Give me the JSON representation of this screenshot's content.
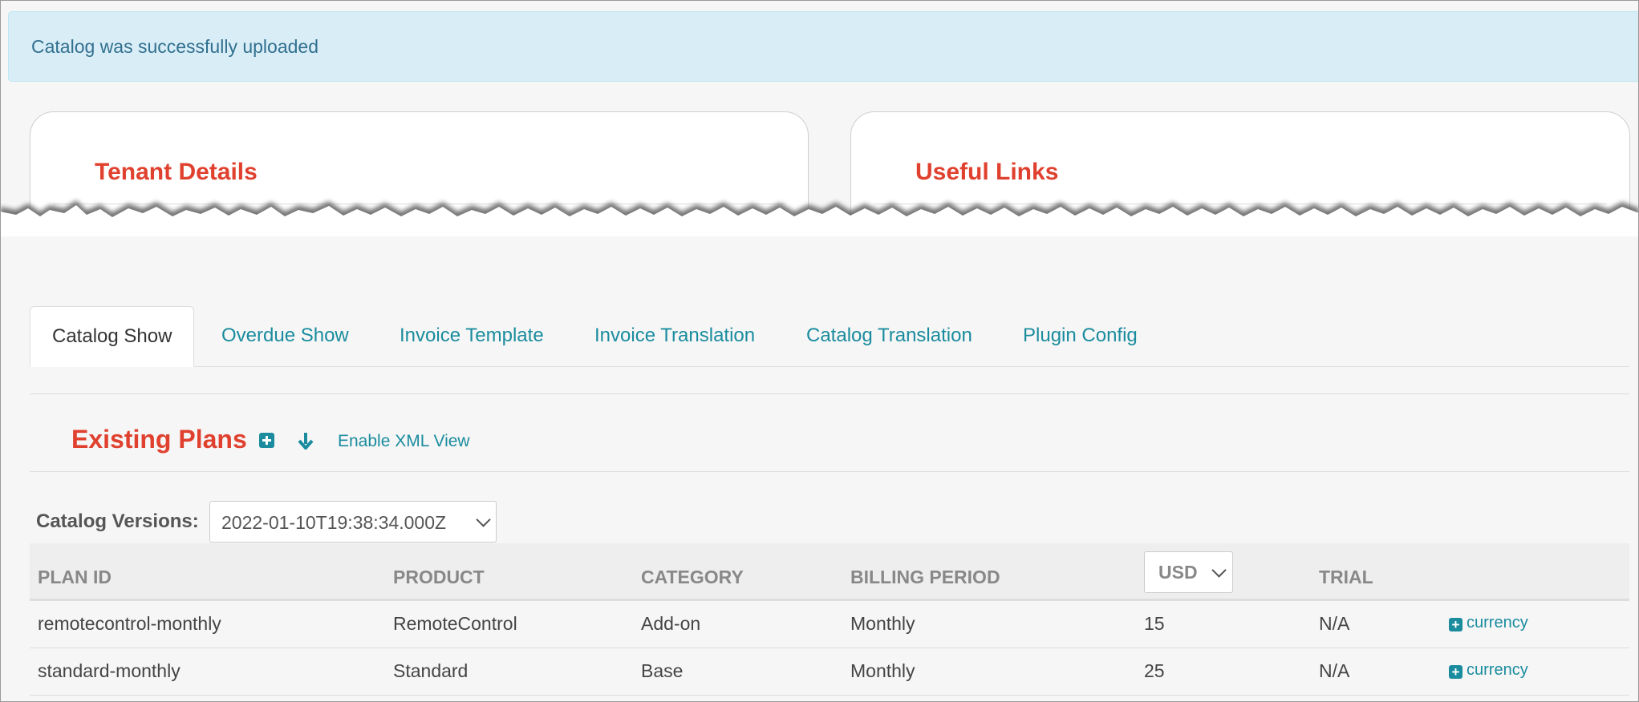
{
  "alert": {
    "message": "Catalog was successfully uploaded"
  },
  "panels": {
    "tenant_title": "Tenant Details",
    "links_title": "Useful Links"
  },
  "tabs": [
    {
      "label": "Catalog Show",
      "active": true
    },
    {
      "label": "Overdue Show"
    },
    {
      "label": "Invoice Template"
    },
    {
      "label": "Invoice Translation"
    },
    {
      "label": "Catalog Translation"
    },
    {
      "label": "Plugin Config"
    }
  ],
  "plans": {
    "title": "Existing Plans",
    "add_icon": "plus-square-icon",
    "download_icon": "arrow-down-icon",
    "xml_link": "Enable XML View"
  },
  "catalog_versions": {
    "label": "Catalog Versions:",
    "selected": "2022-01-10T19:38:34.000Z"
  },
  "table": {
    "headers": {
      "plan_id": "PLAN ID",
      "product": "PRODUCT",
      "category": "CATEGORY",
      "billing_period": "BILLING PERIOD",
      "currency": "USD",
      "trial": "TRIAL"
    },
    "rows": [
      {
        "plan_id": "remotecontrol-monthly",
        "product": "RemoteControl",
        "category": "Add-on",
        "billing_period": "Monthly",
        "price": "15",
        "trial": "N/A",
        "action": "currency"
      },
      {
        "plan_id": "standard-monthly",
        "product": "Standard",
        "category": "Base",
        "billing_period": "Monthly",
        "price": "25",
        "trial": "N/A",
        "action": "currency"
      }
    ]
  },
  "colors": {
    "accent": "#e0412f",
    "link": "#1a8c9e",
    "alert_bg": "#d9edf7",
    "alert_text": "#31708f"
  }
}
